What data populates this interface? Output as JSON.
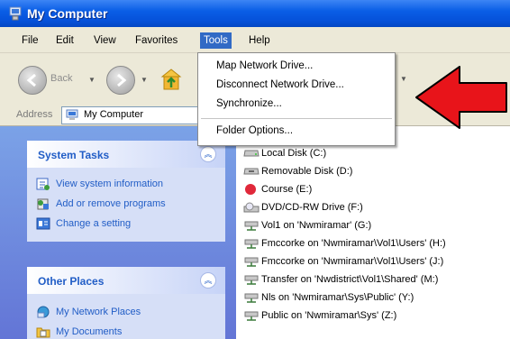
{
  "window": {
    "title": "My Computer"
  },
  "menubar": {
    "items": [
      "File",
      "Edit",
      "View",
      "Favorites",
      "Tools",
      "Help"
    ],
    "active": "Tools"
  },
  "toolbar": {
    "back_label": "Back"
  },
  "address": {
    "label": "Address",
    "value": "My Computer"
  },
  "tools_menu": {
    "items": [
      "Map Network Drive...",
      "Disconnect Network Drive...",
      "Synchronize...",
      "Folder Options..."
    ]
  },
  "system_tasks": {
    "title": "System Tasks",
    "items": [
      "View system information",
      "Add or remove programs",
      "Change a setting"
    ]
  },
  "other_places": {
    "title": "Other Places",
    "items": [
      "My Network Places",
      "My Documents"
    ]
  },
  "drives": [
    "Local Disk (C:)",
    "Removable Disk (D:)",
    "Course (E:)",
    "DVD/CD-RW Drive (F:)",
    "Vol1 on 'Nwmiramar' (G:)",
    "Fmccorke on 'Nwmiramar\\Vol1\\Users' (H:)",
    "Fmccorke on 'Nwmiramar\\Vol1\\Users' (J:)",
    "Transfer on 'Nwdistrict\\Vol1\\Shared' (M:)",
    "Nls on 'Nwmiramar\\Sys\\Public' (Y:)",
    "Public on 'Nwmiramar\\Sys' (Z:)"
  ],
  "colors": {
    "title_bar": "#0550d8",
    "menu_highlight": "#316ac5",
    "callout_arrow": "#e8141a",
    "task_link": "#215dc6"
  }
}
